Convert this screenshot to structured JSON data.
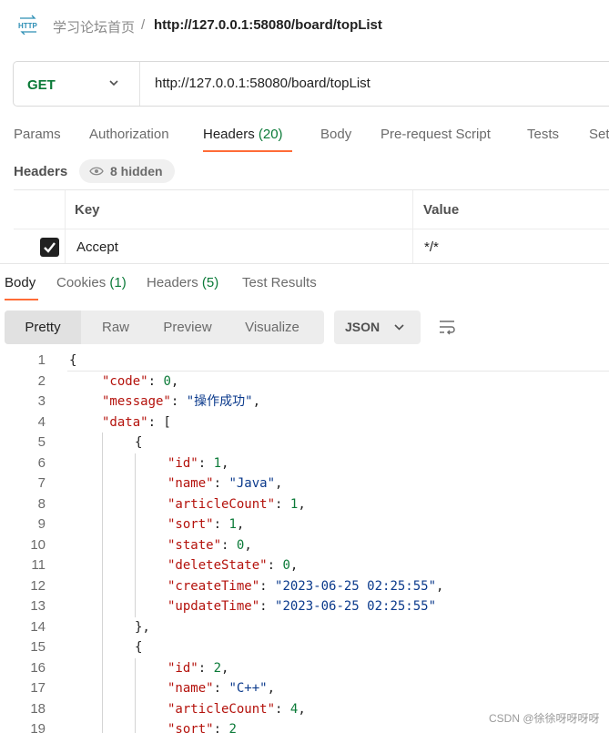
{
  "breadcrumb": {
    "parent": "学习论坛首页",
    "separator": "/",
    "current": "http://127.0.0.1:58080/board/topList",
    "icon": "http-icon"
  },
  "request": {
    "method": "GET",
    "url": "http://127.0.0.1:58080/board/topList"
  },
  "request_tabs": [
    {
      "label": "Params"
    },
    {
      "label": "Authorization"
    },
    {
      "label": "Headers",
      "count": "(20)"
    },
    {
      "label": "Body"
    },
    {
      "label": "Pre-request Script"
    },
    {
      "label": "Tests"
    },
    {
      "label": "Set"
    }
  ],
  "headers_section": {
    "title": "Headers",
    "hidden_label": "8 hidden",
    "columns": {
      "key": "Key",
      "value": "Value"
    },
    "rows": [
      {
        "key": "Accept",
        "value": "*/*",
        "checked": true
      }
    ]
  },
  "response_tabs": [
    {
      "label": "Body"
    },
    {
      "label": "Cookies",
      "count": "(1)"
    },
    {
      "label": "Headers",
      "count": "(5)"
    },
    {
      "label": "Test Results"
    }
  ],
  "view_modes": [
    "Pretty",
    "Raw",
    "Preview",
    "Visualize"
  ],
  "format": "JSON",
  "code_lines": [
    {
      "n": "1",
      "segs": [
        [
          "p",
          "{"
        ]
      ]
    },
    {
      "n": "2",
      "segs": [
        [
          "k",
          "\"code\""
        ],
        [
          "p",
          ": "
        ],
        [
          "n",
          "0"
        ],
        [
          "p",
          ","
        ]
      ]
    },
    {
      "n": "3",
      "segs": [
        [
          "k",
          "\"message\""
        ],
        [
          "p",
          ": "
        ],
        [
          "s",
          "\"操作成功\""
        ],
        [
          "p",
          ","
        ]
      ]
    },
    {
      "n": "4",
      "segs": [
        [
          "k",
          "\"data\""
        ],
        [
          "p",
          ": ["
        ]
      ]
    },
    {
      "n": "5",
      "segs": [
        [
          "p",
          "{"
        ]
      ]
    },
    {
      "n": "6",
      "segs": [
        [
          "k",
          "\"id\""
        ],
        [
          "p",
          ": "
        ],
        [
          "n",
          "1"
        ],
        [
          "p",
          ","
        ]
      ]
    },
    {
      "n": "7",
      "segs": [
        [
          "k",
          "\"name\""
        ],
        [
          "p",
          ": "
        ],
        [
          "s",
          "\"Java\""
        ],
        [
          "p",
          ","
        ]
      ]
    },
    {
      "n": "8",
      "segs": [
        [
          "k",
          "\"articleCount\""
        ],
        [
          "p",
          ": "
        ],
        [
          "n",
          "1"
        ],
        [
          "p",
          ","
        ]
      ]
    },
    {
      "n": "9",
      "segs": [
        [
          "k",
          "\"sort\""
        ],
        [
          "p",
          ": "
        ],
        [
          "n",
          "1"
        ],
        [
          "p",
          ","
        ]
      ]
    },
    {
      "n": "10",
      "segs": [
        [
          "k",
          "\"state\""
        ],
        [
          "p",
          ": "
        ],
        [
          "n",
          "0"
        ],
        [
          "p",
          ","
        ]
      ]
    },
    {
      "n": "11",
      "segs": [
        [
          "k",
          "\"deleteState\""
        ],
        [
          "p",
          ": "
        ],
        [
          "n",
          "0"
        ],
        [
          "p",
          ","
        ]
      ]
    },
    {
      "n": "12",
      "segs": [
        [
          "k",
          "\"createTime\""
        ],
        [
          "p",
          ": "
        ],
        [
          "s",
          "\"2023-06-25 02:25:55\""
        ],
        [
          "p",
          ","
        ]
      ]
    },
    {
      "n": "13",
      "segs": [
        [
          "k",
          "\"updateTime\""
        ],
        [
          "p",
          ": "
        ],
        [
          "s",
          "\"2023-06-25 02:25:55\""
        ]
      ]
    },
    {
      "n": "14",
      "segs": [
        [
          "p",
          "},"
        ]
      ]
    },
    {
      "n": "15",
      "segs": [
        [
          "p",
          "{"
        ]
      ]
    },
    {
      "n": "16",
      "segs": [
        [
          "k",
          "\"id\""
        ],
        [
          "p",
          ": "
        ],
        [
          "n",
          "2"
        ],
        [
          "p",
          ","
        ]
      ]
    },
    {
      "n": "17",
      "segs": [
        [
          "k",
          "\"name\""
        ],
        [
          "p",
          ": "
        ],
        [
          "s",
          "\"C++\""
        ],
        [
          "p",
          ","
        ]
      ]
    },
    {
      "n": "18",
      "segs": [
        [
          "k",
          "\"articleCount\""
        ],
        [
          "p",
          ": "
        ],
        [
          "n",
          "4"
        ],
        [
          "p",
          ","
        ]
      ]
    },
    {
      "n": "19",
      "segs": [
        [
          "k",
          "\"sort\""
        ],
        [
          "p",
          ": "
        ],
        [
          "n",
          "2"
        ]
      ]
    }
  ],
  "watermark": "CSDN @徐徐呀呀呀呀",
  "colors": {
    "accent": "#ff6c37",
    "method_get": "#0b7a38",
    "json_key": "#b4120c",
    "json_number": "#0b7a38",
    "json_string": "#0b3a8c"
  }
}
